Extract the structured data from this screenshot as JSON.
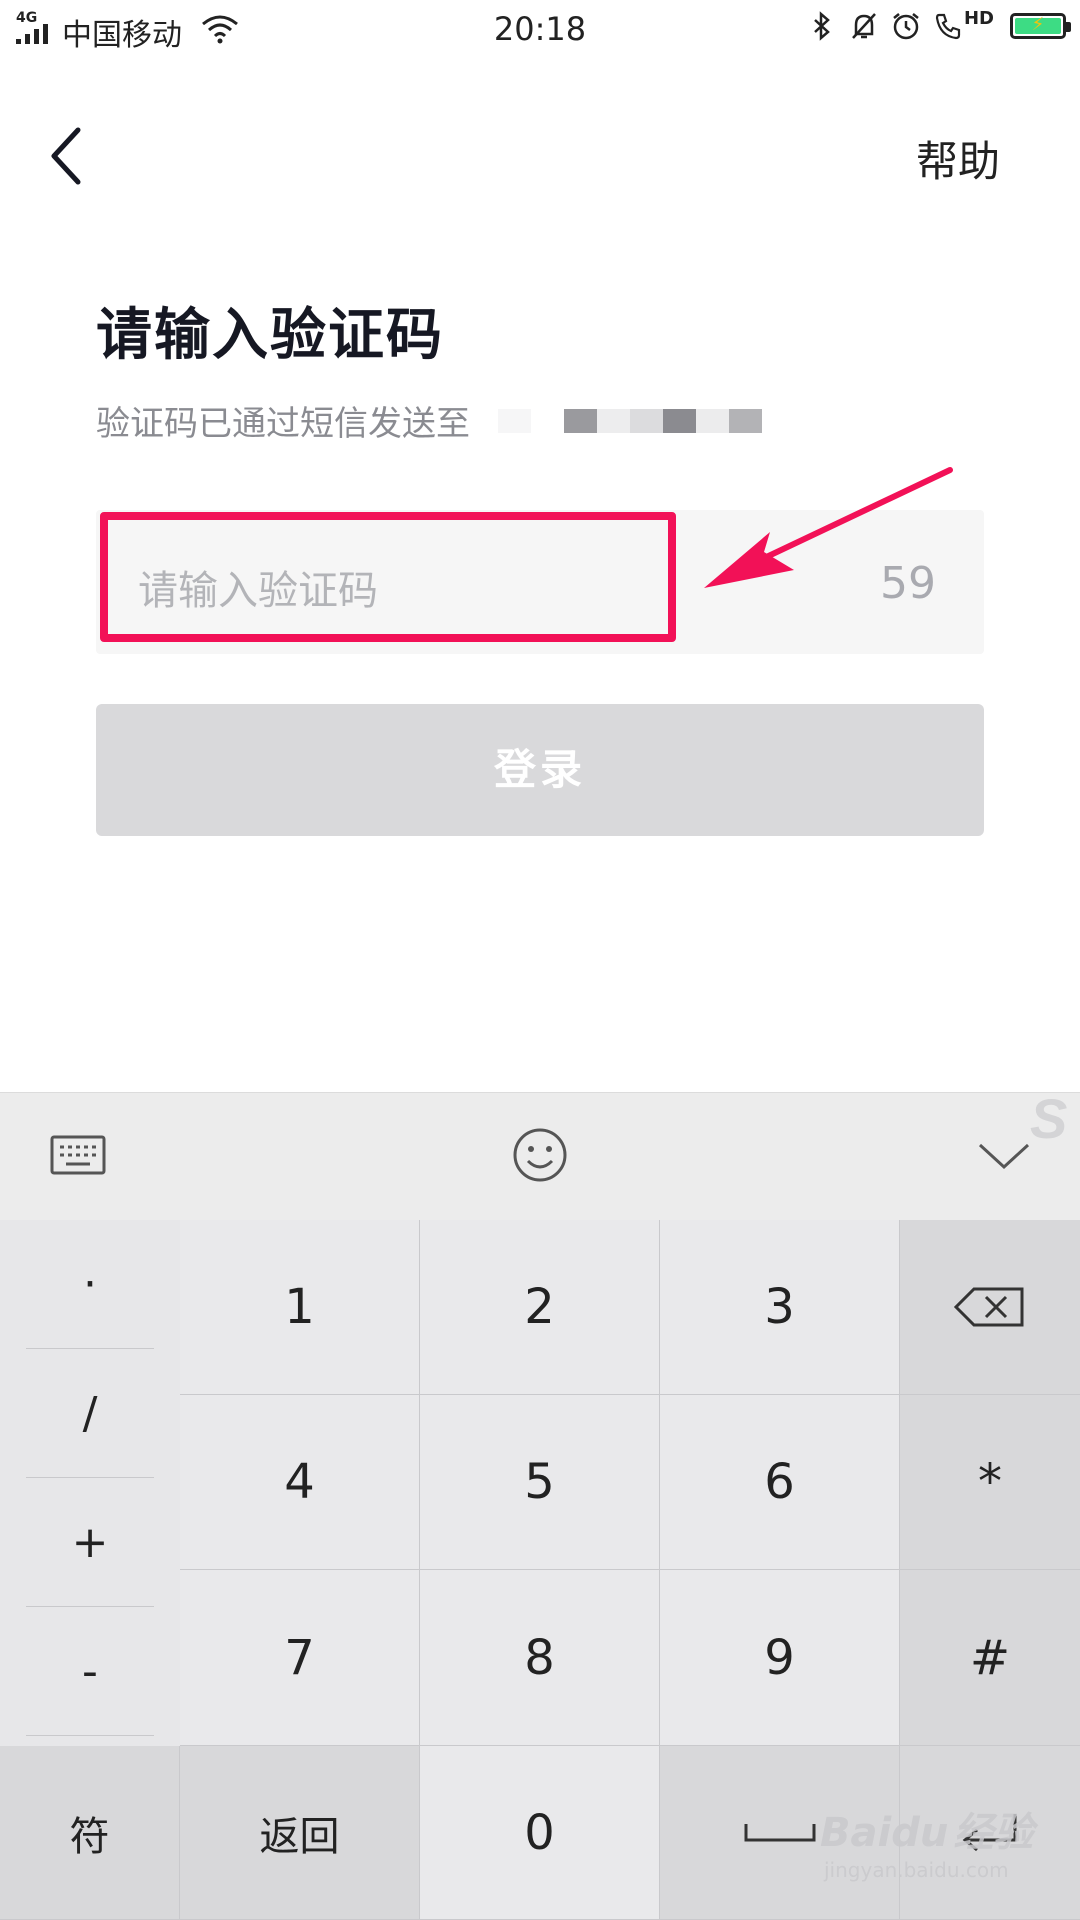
{
  "status_bar": {
    "network_type": "4G",
    "carrier": "中国移动",
    "time": "20:18",
    "hd_label": "HD"
  },
  "header": {
    "help_label": "帮助"
  },
  "main": {
    "title": "请输入验证码",
    "subtitle": "验证码已通过短信发送至",
    "code_input": {
      "placeholder": "请输入验证码",
      "value": ""
    },
    "countdown": "59",
    "login_label": "登录",
    "login_enabled": false
  },
  "keyboard": {
    "side_keys": [
      "·",
      "/",
      "+",
      "-"
    ],
    "digit_rows": [
      [
        "1",
        "2",
        "3"
      ],
      [
        "4",
        "5",
        "6"
      ],
      [
        "7",
        "8",
        "9"
      ]
    ],
    "right_keys": [
      "*",
      "#"
    ],
    "bottom_row": {
      "symbols": "符",
      "back": "返回",
      "zero": "0"
    }
  },
  "watermark": {
    "brand": "Baidu",
    "brand_cn": "经验",
    "url": "jingyan.baidu.com"
  },
  "colors": {
    "accent_highlight": "#f21157",
    "button_disabled": "#d9d9db",
    "battery": "#3ddc84"
  }
}
